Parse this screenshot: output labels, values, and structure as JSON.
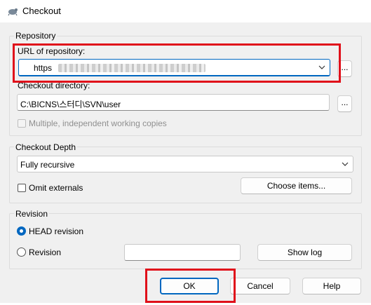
{
  "window": {
    "title": "Checkout",
    "icon": "tortoise-svn-icon"
  },
  "repository": {
    "group_label": "Repository",
    "url_label": "URL of repository:",
    "url_value": "https",
    "url_browse": "...",
    "dir_label": "Checkout directory:",
    "dir_value": "C:\\BICNS\\스터디\\SVN\\user",
    "dir_browse": "...",
    "multiple_label": "Multiple, independent working copies",
    "multiple_checked": false
  },
  "depth": {
    "group_label": "Checkout Depth",
    "selected": "Fully recursive",
    "omit_externals_label": "Omit externals",
    "omit_externals_checked": false,
    "choose_items_label": "Choose items..."
  },
  "revision": {
    "group_label": "Revision",
    "head_label": "HEAD revision",
    "head_selected": true,
    "revision_label": "Revision",
    "revision_value": "",
    "show_log_label": "Show log"
  },
  "buttons": {
    "ok": "OK",
    "cancel": "Cancel",
    "help": "Help"
  },
  "colors": {
    "accent": "#0067c0",
    "highlight": "#e0101a"
  }
}
